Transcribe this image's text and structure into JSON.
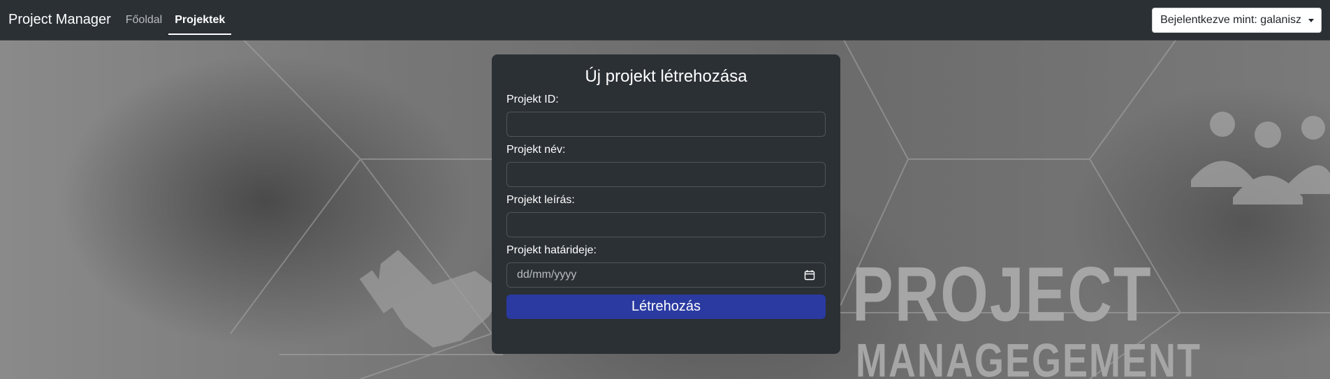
{
  "navbar": {
    "brand": "Project Manager",
    "links": [
      {
        "label": "Főoldal",
        "active": false
      },
      {
        "label": "Projektek",
        "active": true
      }
    ],
    "user_dropdown": "Bejelentkezve mint: galanisz"
  },
  "background": {
    "headline_top": "PROJECT",
    "headline_bottom": "MANAGEGEMENT"
  },
  "form": {
    "title": "Új projekt létrehozása",
    "fields": [
      {
        "label": "Projekt ID:",
        "value": ""
      },
      {
        "label": "Projekt név:",
        "value": ""
      },
      {
        "label": "Projekt leírás:",
        "value": ""
      },
      {
        "label": "Projekt határideje:",
        "placeholder": "dd/mm/yyyy",
        "icon": "calendar-icon"
      }
    ],
    "submit_label": "Létrehozás"
  },
  "colors": {
    "navbar_bg": "#2b3035",
    "card_bg": "#2b3035",
    "button_bg": "#2a3aa1"
  }
}
